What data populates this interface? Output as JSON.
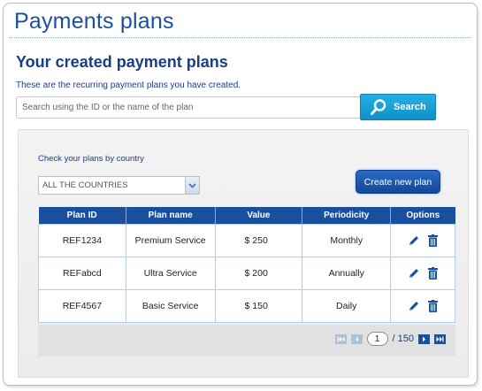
{
  "header": {
    "title": "Payments plans"
  },
  "section": {
    "title": "Your created payment plans",
    "subtitle": "These are the recurring payment plans you have created."
  },
  "search": {
    "placeholder": "Search using the ID or the name of the plan",
    "button_label": "Search"
  },
  "filter": {
    "label": "Check your plans by country",
    "selected": "ALL THE COUNTRIES"
  },
  "actions": {
    "create_label": "Create new plan"
  },
  "table": {
    "columns": [
      "Plan ID",
      "Plan name",
      "Value",
      "Periodicity",
      "Options"
    ],
    "rows": [
      {
        "id": "REF1234",
        "name": "Premium Service",
        "value": "$ 250",
        "periodicity": "Monthly"
      },
      {
        "id": "REFabcd",
        "name": "Ultra Service",
        "value": "$ 200",
        "periodicity": "Annually"
      },
      {
        "id": "REF4567",
        "name": "Basic Service",
        "value": "$ 150",
        "periodicity": "Daily"
      }
    ]
  },
  "pagination": {
    "current": "1",
    "total_label": "/ 150"
  },
  "icons": {
    "search": "search-icon",
    "edit": "pencil-icon",
    "delete": "trash-icon",
    "dropdown": "chevron-down-icon"
  },
  "colors": {
    "brand": "#1a4f9e",
    "accent": "#1e9fd8"
  }
}
